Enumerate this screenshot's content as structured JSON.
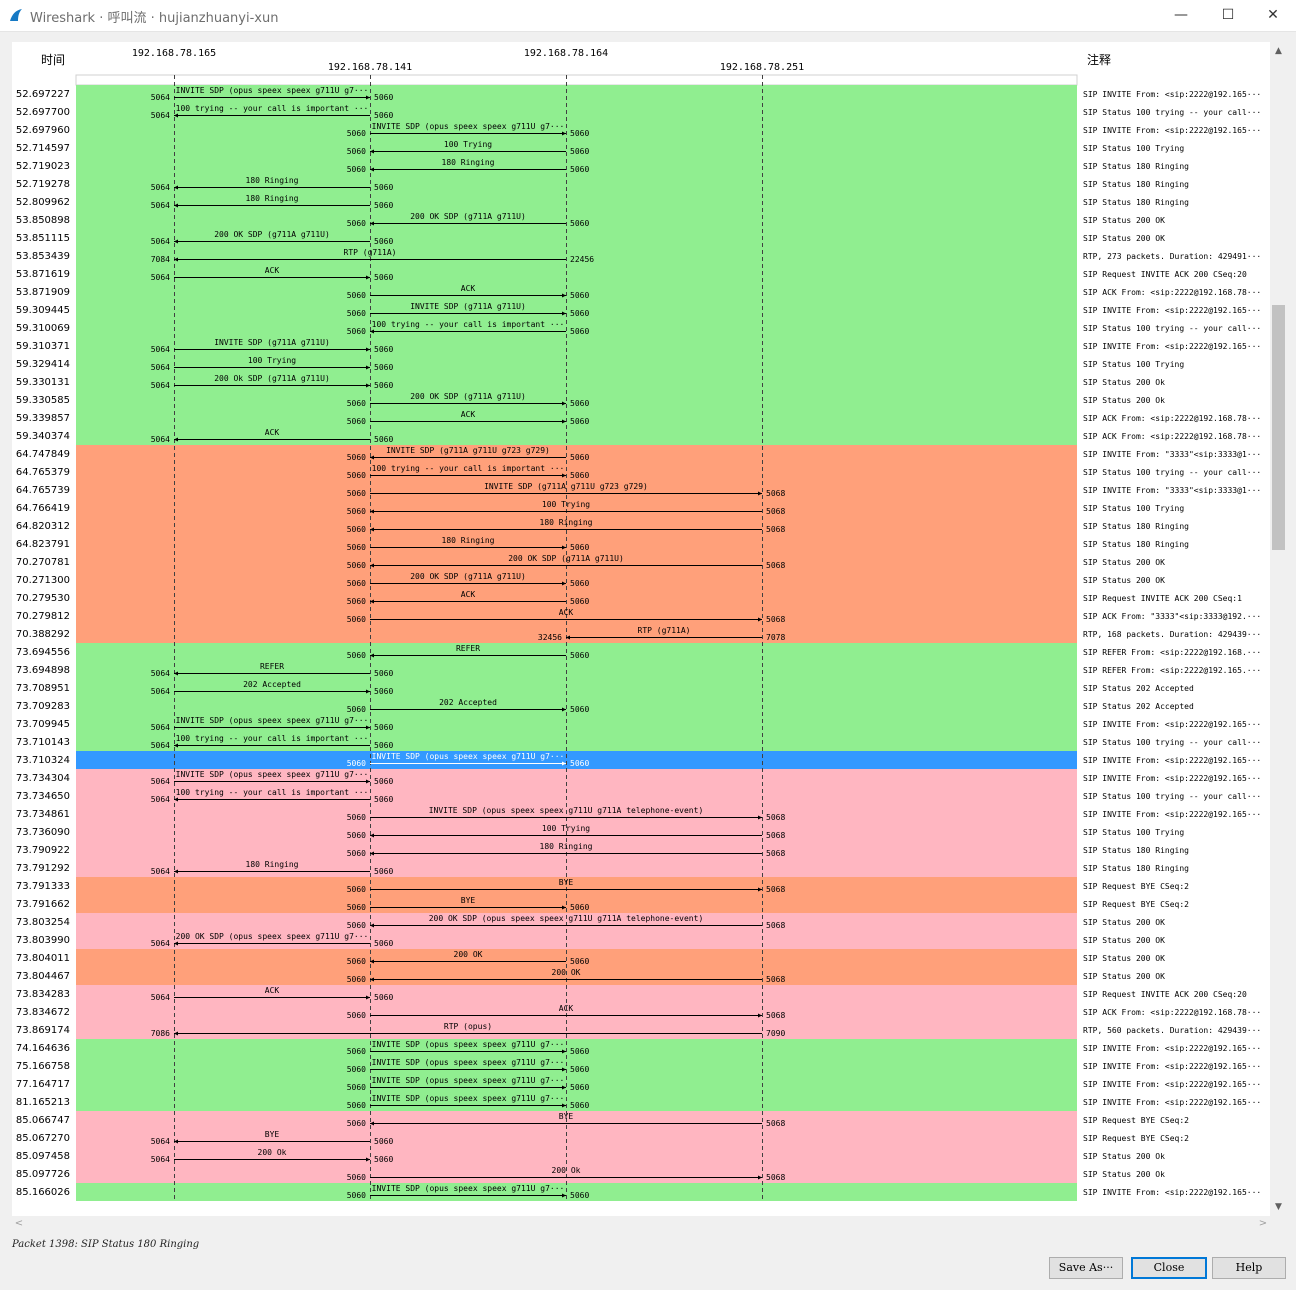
{
  "window": {
    "title": "Wireshark · 呼叫流 · hujianzhuanyi-xun",
    "minimize_glyph": "—",
    "maximize_glyph": "☐",
    "close_glyph": "✕"
  },
  "header": {
    "time_label": "时间",
    "comment_label": "注释",
    "hosts": [
      "192.168.78.165",
      "192.168.78.141",
      "192.168.78.164",
      "192.168.78.251"
    ]
  },
  "colors": {
    "green": "#90ee90",
    "orange": "#ffa07a",
    "pink": "#ffb6c1",
    "selected": "#3399ff"
  },
  "rows": [
    {
      "t": "52.697227",
      "c": "green",
      "f": 0,
      "to": 1,
      "fp": "5064",
      "tp": "5060",
      "lbl": "INVITE SDP (opus speex speex g711U g7···",
      "cm": "SIP INVITE From: <sip:2222@192.165···"
    },
    {
      "t": "52.697700",
      "c": "green",
      "f": 1,
      "to": 0,
      "fp": "5060",
      "tp": "5064",
      "lbl": "100 trying -- your call is important ···",
      "cm": "SIP Status 100 trying -- your call···"
    },
    {
      "t": "52.697960",
      "c": "green",
      "f": 1,
      "to": 2,
      "fp": "5060",
      "tp": "5060",
      "lbl": "INVITE SDP (opus speex speex g711U g7···",
      "cm": "SIP INVITE From: <sip:2222@192.165···"
    },
    {
      "t": "52.714597",
      "c": "green",
      "f": 2,
      "to": 1,
      "fp": "5060",
      "tp": "5060",
      "lbl": "100 Trying",
      "cm": "SIP Status 100 Trying"
    },
    {
      "t": "52.719023",
      "c": "green",
      "f": 2,
      "to": 1,
      "fp": "5060",
      "tp": "5060",
      "lbl": "180 Ringing",
      "cm": "SIP Status 180 Ringing"
    },
    {
      "t": "52.719278",
      "c": "green",
      "f": 1,
      "to": 0,
      "fp": "5060",
      "tp": "5064",
      "lbl": "180 Ringing",
      "cm": "SIP Status 180 Ringing"
    },
    {
      "t": "52.809962",
      "c": "green",
      "f": 1,
      "to": 0,
      "fp": "5060",
      "tp": "5064",
      "lbl": "180 Ringing",
      "cm": "SIP Status 180 Ringing"
    },
    {
      "t": "53.850898",
      "c": "green",
      "f": 2,
      "to": 1,
      "fp": "5060",
      "tp": "5060",
      "lbl": "200 OK SDP (g711A g711U)",
      "cm": "SIP Status 200 OK"
    },
    {
      "t": "53.851115",
      "c": "green",
      "f": 1,
      "to": 0,
      "fp": "5060",
      "tp": "5064",
      "lbl": "200 OK SDP (g711A g711U)",
      "cm": "SIP Status 200 OK"
    },
    {
      "t": "53.853439",
      "c": "green",
      "f": 2,
      "to": 0,
      "fp": "22456",
      "tp": "7084",
      "lbl": "RTP (g711A)",
      "cm": "RTP, 273 packets. Duration: 429491···"
    },
    {
      "t": "53.871619",
      "c": "green",
      "f": 0,
      "to": 1,
      "fp": "5064",
      "tp": "5060",
      "lbl": "ACK",
      "cm": "SIP Request INVITE ACK 200 CSeq:20"
    },
    {
      "t": "53.871909",
      "c": "green",
      "f": 1,
      "to": 2,
      "fp": "5060",
      "tp": "5060",
      "lbl": "ACK",
      "cm": "SIP ACK From: <sip:2222@192.168.78···"
    },
    {
      "t": "59.309445",
      "c": "green",
      "f": 1,
      "to": 2,
      "fp": "5060",
      "tp": "5060",
      "lbl": "INVITE SDP (g711A g711U)",
      "cm": "SIP INVITE From: <sip:2222@192.165···"
    },
    {
      "t": "59.310069",
      "c": "green",
      "f": 2,
      "to": 1,
      "fp": "5060",
      "tp": "5060",
      "lbl": "100 trying -- your call is important ···",
      "cm": "SIP Status 100 trying -- your call···"
    },
    {
      "t": "59.310371",
      "c": "green",
      "f": 0,
      "to": 1,
      "fp": "5064",
      "tp": "5060",
      "lbl": "INVITE SDP (g711A g711U)",
      "cm": "SIP INVITE From: <sip:2222@192.165···"
    },
    {
      "t": "59.329414",
      "c": "green",
      "f": 0,
      "to": 1,
      "fp": "5064",
      "tp": "5060",
      "lbl": "100 Trying",
      "cm": "SIP Status 100 Trying"
    },
    {
      "t": "59.330131",
      "c": "green",
      "f": 0,
      "to": 1,
      "fp": "5064",
      "tp": "5060",
      "lbl": "200 Ok SDP (g711A g711U)",
      "cm": "SIP Status 200 Ok"
    },
    {
      "t": "59.330585",
      "c": "green",
      "f": 1,
      "to": 2,
      "fp": "5060",
      "tp": "5060",
      "lbl": "200 OK SDP (g711A g711U)",
      "cm": "SIP Status 200 Ok"
    },
    {
      "t": "59.339857",
      "c": "green",
      "f": 1,
      "to": 2,
      "fp": "5060",
      "tp": "5060",
      "lbl": "ACK",
      "cm": "SIP ACK From: <sip:2222@192.168.78···"
    },
    {
      "t": "59.340374",
      "c": "green",
      "f": 1,
      "to": 0,
      "fp": "5060",
      "tp": "5064",
      "lbl": "ACK",
      "cm": "SIP ACK From: <sip:2222@192.168.78···"
    },
    {
      "t": "64.747849",
      "c": "orange",
      "f": 2,
      "to": 1,
      "fp": "5060",
      "tp": "5060",
      "lbl": "INVITE SDP (g711A g711U g723 g729)",
      "cm": "SIP INVITE From: \"3333\"<sip:3333@1···"
    },
    {
      "t": "64.765379",
      "c": "orange",
      "f": 1,
      "to": 2,
      "fp": "5060",
      "tp": "5060",
      "lbl": "100 trying -- your call is important ···",
      "cm": "SIP Status 100 trying -- your call···"
    },
    {
      "t": "64.765739",
      "c": "orange",
      "f": 1,
      "to": 3,
      "fp": "5060",
      "tp": "5068",
      "lbl": "INVITE SDP (g711A g711U g723 g729)",
      "cm": "SIP INVITE From: \"3333\"<sip:3333@1···"
    },
    {
      "t": "64.766419",
      "c": "orange",
      "f": 3,
      "to": 1,
      "fp": "5068",
      "tp": "5060",
      "lbl": "100 Trying",
      "cm": "SIP Status 100 Trying"
    },
    {
      "t": "64.820312",
      "c": "orange",
      "f": 3,
      "to": 1,
      "fp": "5068",
      "tp": "5060",
      "lbl": "180 Ringing",
      "cm": "SIP Status 180 Ringing"
    },
    {
      "t": "64.823791",
      "c": "orange",
      "f": 1,
      "to": 2,
      "fp": "5060",
      "tp": "5060",
      "lbl": "180 Ringing",
      "cm": "SIP Status 180 Ringing"
    },
    {
      "t": "70.270781",
      "c": "orange",
      "f": 3,
      "to": 1,
      "fp": "5068",
      "tp": "5060",
      "lbl": "200 OK SDP (g711A g711U)",
      "cm": "SIP Status 200 OK"
    },
    {
      "t": "70.271300",
      "c": "orange",
      "f": 1,
      "to": 2,
      "fp": "5060",
      "tp": "5060",
      "lbl": "200 OK SDP (g711A g711U)",
      "cm": "SIP Status 200 OK"
    },
    {
      "t": "70.279530",
      "c": "orange",
      "f": 2,
      "to": 1,
      "fp": "5060",
      "tp": "5060",
      "lbl": "ACK",
      "cm": "SIP Request INVITE ACK 200 CSeq:1"
    },
    {
      "t": "70.279812",
      "c": "orange",
      "f": 1,
      "to": 3,
      "fp": "5060",
      "tp": "5068",
      "lbl": "ACK",
      "cm": "SIP ACK From: \"3333\"<sip:3333@192.···"
    },
    {
      "t": "70.388292",
      "c": "orange",
      "f": 3,
      "to": 2,
      "fp": "7078",
      "tp": "32456",
      "lbl": "RTP (g711A)",
      "cm": "RTP, 168 packets. Duration: 429439···"
    },
    {
      "t": "73.694556",
      "c": "green",
      "f": 2,
      "to": 1,
      "fp": "5060",
      "tp": "5060",
      "lbl": "REFER",
      "cm": "SIP REFER From: <sip:2222@192.168.···"
    },
    {
      "t": "73.694898",
      "c": "green",
      "f": 1,
      "to": 0,
      "fp": "5060",
      "tp": "5064",
      "lbl": "REFER",
      "cm": "SIP REFER From: <sip:2222@192.165.···"
    },
    {
      "t": "73.708951",
      "c": "green",
      "f": 0,
      "to": 1,
      "fp": "5064",
      "tp": "5060",
      "lbl": "202 Accepted",
      "cm": "SIP Status 202 Accepted"
    },
    {
      "t": "73.709283",
      "c": "green",
      "f": 1,
      "to": 2,
      "fp": "5060",
      "tp": "5060",
      "lbl": "202 Accepted",
      "cm": "SIP Status 202 Accepted"
    },
    {
      "t": "73.709945",
      "c": "green",
      "f": 0,
      "to": 1,
      "fp": "5064",
      "tp": "5060",
      "lbl": "INVITE SDP (opus speex speex g711U g7···",
      "cm": "SIP INVITE From: <sip:2222@192.165···"
    },
    {
      "t": "73.710143",
      "c": "green",
      "f": 1,
      "to": 0,
      "fp": "5060",
      "tp": "5064",
      "lbl": "100 trying -- your call is important ···",
      "cm": "SIP Status 100 trying -- your call···"
    },
    {
      "t": "73.710324",
      "c": "selected",
      "f": 1,
      "to": 2,
      "fp": "5060",
      "tp": "5060",
      "lbl": "INVITE SDP (opus speex speex g711U g7···",
      "cm": "SIP INVITE From: <sip:2222@192.165···"
    },
    {
      "t": "73.734304",
      "c": "pink",
      "f": 0,
      "to": 1,
      "fp": "5064",
      "tp": "5060",
      "lbl": "INVITE SDP (opus speex speex g711U g7···",
      "cm": "SIP INVITE From: <sip:2222@192.165···"
    },
    {
      "t": "73.734650",
      "c": "pink",
      "f": 1,
      "to": 0,
      "fp": "5060",
      "tp": "5064",
      "lbl": "100 trying -- your call is important ···",
      "cm": "SIP Status 100 trying -- your call···"
    },
    {
      "t": "73.734861",
      "c": "pink",
      "f": 1,
      "to": 3,
      "fp": "5060",
      "tp": "5068",
      "lbl": "INVITE SDP (opus speex speex g711U g711A telephone-event)",
      "cm": "SIP INVITE From: <sip:2222@192.165···"
    },
    {
      "t": "73.736090",
      "c": "pink",
      "f": 3,
      "to": 1,
      "fp": "5068",
      "tp": "5060",
      "lbl": "100 Trying",
      "cm": "SIP Status 100 Trying"
    },
    {
      "t": "73.790922",
      "c": "pink",
      "f": 3,
      "to": 1,
      "fp": "5068",
      "tp": "5060",
      "lbl": "180 Ringing",
      "cm": "SIP Status 180 Ringing"
    },
    {
      "t": "73.791292",
      "c": "pink",
      "f": 1,
      "to": 0,
      "fp": "5060",
      "tp": "5064",
      "lbl": "180 Ringing",
      "cm": "SIP Status 180 Ringing"
    },
    {
      "t": "73.791333",
      "c": "orange",
      "f": 1,
      "to": 3,
      "fp": "5060",
      "tp": "5068",
      "lbl": "BYE",
      "cm": "SIP Request BYE CSeq:2"
    },
    {
      "t": "73.791662",
      "c": "orange",
      "f": 1,
      "to": 2,
      "fp": "5060",
      "tp": "5060",
      "lbl": "BYE",
      "cm": "SIP Request BYE CSeq:2"
    },
    {
      "t": "73.803254",
      "c": "pink",
      "f": 3,
      "to": 1,
      "fp": "5068",
      "tp": "5060",
      "lbl": "200 OK SDP (opus speex speex g711U g711A telephone-event)",
      "cm": "SIP Status 200 OK"
    },
    {
      "t": "73.803990",
      "c": "pink",
      "f": 1,
      "to": 0,
      "fp": "5060",
      "tp": "5064",
      "lbl": "200 OK SDP (opus speex speex g711U g7···",
      "cm": "SIP Status 200 OK"
    },
    {
      "t": "73.804011",
      "c": "orange",
      "f": 2,
      "to": 1,
      "fp": "5060",
      "tp": "5060",
      "lbl": "200 OK",
      "cm": "SIP Status 200 OK"
    },
    {
      "t": "73.804467",
      "c": "orange",
      "f": 3,
      "to": 1,
      "fp": "5068",
      "tp": "5060",
      "lbl": "200 OK",
      "cm": "SIP Status 200 OK"
    },
    {
      "t": "73.834283",
      "c": "pink",
      "f": 0,
      "to": 1,
      "fp": "5064",
      "tp": "5060",
      "lbl": "ACK",
      "cm": "SIP Request INVITE ACK 200 CSeq:20"
    },
    {
      "t": "73.834672",
      "c": "pink",
      "f": 1,
      "to": 3,
      "fp": "5060",
      "tp": "5068",
      "lbl": "ACK",
      "cm": "SIP ACK From: <sip:2222@192.168.78···"
    },
    {
      "t": "73.869174",
      "c": "pink",
      "f": 3,
      "to": 0,
      "fp": "7090",
      "tp": "7086",
      "lbl": "RTP (opus)",
      "cm": "RTP, 560 packets. Duration: 429439···"
    },
    {
      "t": "74.164636",
      "c": "green",
      "f": 1,
      "to": 2,
      "fp": "5060",
      "tp": "5060",
      "lbl": "INVITE SDP (opus speex speex g711U g7···",
      "cm": "SIP INVITE From: <sip:2222@192.165···"
    },
    {
      "t": "75.166758",
      "c": "green",
      "f": 1,
      "to": 2,
      "fp": "5060",
      "tp": "5060",
      "lbl": "INVITE SDP (opus speex speex g711U g7···",
      "cm": "SIP INVITE From: <sip:2222@192.165···"
    },
    {
      "t": "77.164717",
      "c": "green",
      "f": 1,
      "to": 2,
      "fp": "5060",
      "tp": "5060",
      "lbl": "INVITE SDP (opus speex speex g711U g7···",
      "cm": "SIP INVITE From: <sip:2222@192.165···"
    },
    {
      "t": "81.165213",
      "c": "green",
      "f": 1,
      "to": 2,
      "fp": "5060",
      "tp": "5060",
      "lbl": "INVITE SDP (opus speex speex g711U g7···",
      "cm": "SIP INVITE From: <sip:2222@192.165···"
    },
    {
      "t": "85.066747",
      "c": "pink",
      "f": 3,
      "to": 1,
      "fp": "5068",
      "tp": "5060",
      "lbl": "BYE",
      "cm": "SIP Request BYE CSeq:2"
    },
    {
      "t": "85.067270",
      "c": "pink",
      "f": 1,
      "to": 0,
      "fp": "5060",
      "tp": "5064",
      "lbl": "BYE",
      "cm": "SIP Request BYE CSeq:2"
    },
    {
      "t": "85.097458",
      "c": "pink",
      "f": 0,
      "to": 1,
      "fp": "5064",
      "tp": "5060",
      "lbl": "200 Ok",
      "cm": "SIP Status 200 Ok"
    },
    {
      "t": "85.097726",
      "c": "pink",
      "f": 1,
      "to": 3,
      "fp": "5060",
      "tp": "5068",
      "lbl": "200 Ok",
      "cm": "SIP Status 200 Ok"
    },
    {
      "t": "85.166026",
      "c": "green",
      "f": 1,
      "to": 2,
      "fp": "5060",
      "tp": "5060",
      "lbl": "INVITE SDP (opus speex speex g711U g7···",
      "cm": "SIP INVITE From: <sip:2222@192.165···"
    }
  ],
  "status_bar": {
    "text": "Packet 1398: SIP Status 180 Ringing"
  },
  "buttons": {
    "save_as": "Save As···",
    "close": "Close",
    "help": "Help"
  },
  "scroll": {
    "up_glyph": "▲",
    "down_glyph": "▼",
    "left_glyph": "<",
    "right_glyph": ">"
  }
}
